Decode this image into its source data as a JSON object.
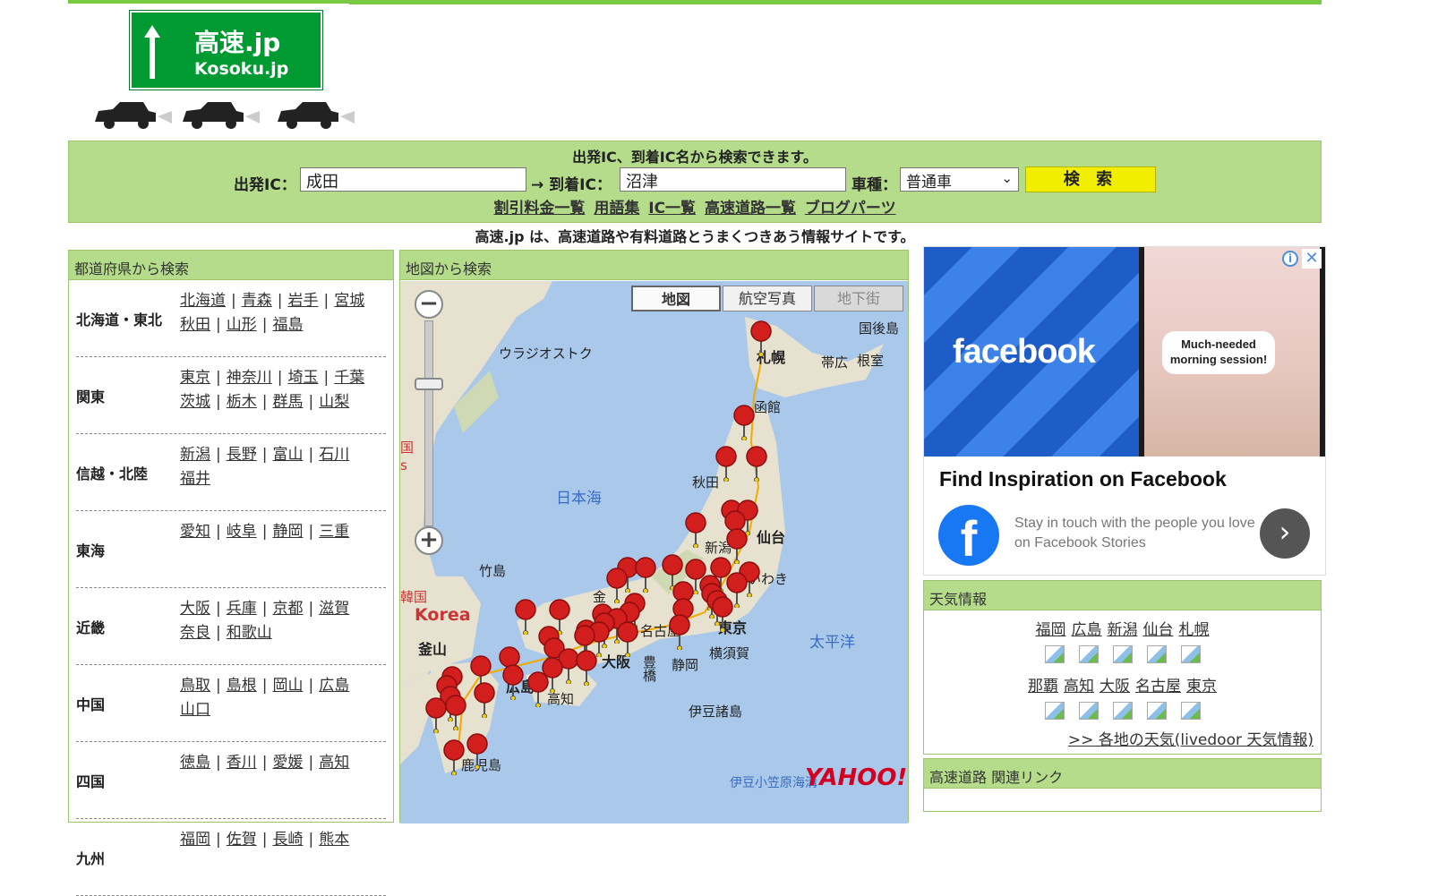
{
  "logo": {
    "line1": "高速.jp",
    "line2": "Kosoku.jp"
  },
  "search": {
    "title": "出発IC、到着IC名から検索できます。",
    "from_label": "出発IC：",
    "from_value": "成田",
    "to_label": "→ 到着IC：",
    "to_value": "沼津",
    "vehicle_label": "車種：",
    "vehicle_value": "普通車",
    "submit_label": "検 索",
    "links": [
      "割引料金一覧",
      "用語集",
      "IC一覧",
      "高速道路一覧",
      "ブログパーツ"
    ]
  },
  "tagline": "高速.jp は、高速道路や有料道路とうまくつきあう情報サイトです。",
  "prefecture_panel": {
    "title": "都道府県から検索",
    "regions": [
      {
        "name": "北海道・東北",
        "prefs": [
          "北海道",
          "青森",
          "岩手",
          "宮城",
          "秋田",
          "山形",
          "福島"
        ]
      },
      {
        "name": "関東",
        "prefs": [
          "東京",
          "神奈川",
          "埼玉",
          "千葉",
          "茨城",
          "栃木",
          "群馬",
          "山梨"
        ]
      },
      {
        "name": "信越・北陸",
        "prefs": [
          "新潟",
          "長野",
          "富山",
          "石川",
          "福井"
        ]
      },
      {
        "name": "東海",
        "prefs": [
          "愛知",
          "岐阜",
          "静岡",
          "三重"
        ]
      },
      {
        "name": "近畿",
        "prefs": [
          "大阪",
          "兵庫",
          "京都",
          "滋賀",
          "奈良",
          "和歌山"
        ]
      },
      {
        "name": "中国",
        "prefs": [
          "鳥取",
          "島根",
          "岡山",
          "広島",
          "山口"
        ]
      },
      {
        "name": "四国",
        "prefs": [
          "徳島",
          "香川",
          "愛媛",
          "高知"
        ]
      },
      {
        "name": "九州",
        "prefs": [
          "福岡",
          "佐賀",
          "長崎",
          "熊本"
        ]
      }
    ]
  },
  "map_panel": {
    "title": "地図から検索",
    "buttons": [
      "地図",
      "航空写真",
      "地下街"
    ],
    "zoom_in": "+",
    "zoom_out": "−",
    "labels": {
      "sapporo": "札幌",
      "obihiro": "帯広",
      "nemuro": "根室",
      "kunashiri": "国後島",
      "vladivostok": "ウラジオストク",
      "hakodate": "函館",
      "akita": "秋田",
      "sea_of_japan": "日本海",
      "niigata": "新潟",
      "sendai": "仙台",
      "iwaki": "いわき",
      "takeshima": "竹島",
      "korea": "Korea",
      "busan": "釜山",
      "tokyo": "東京",
      "nagoya": "名古屋",
      "osaka": "大阪",
      "yokosuka": "横須賀",
      "shizuoka": "静岡",
      "pacific": "太平洋",
      "kochi": "高知",
      "hiroshima": "広島",
      "kagoshima": "鹿児島",
      "toyohashi": "豊橋",
      "izu_islands": "伊豆諸島",
      "ogasawara": "伊豆小笠原海溝",
      "yahoo": "YAHOO!",
      "kanazawa": "金",
      "korea_hanja": "韓国",
      "china_hanja": "国",
      "china_s": "s"
    }
  },
  "ad": {
    "brand": "facebook",
    "bubble": "Much-needed morning session!",
    "title": "Find Inspiration on Facebook",
    "desc": "Stay in touch with the people you love on Facebook Stories",
    "logo_letter": "f"
  },
  "weather": {
    "title": "天気情報",
    "row1": [
      "福岡",
      "広島",
      "新潟",
      "仙台",
      "札幌"
    ],
    "row2": [
      "那覇",
      "高知",
      "大阪",
      "名古屋",
      "東京"
    ],
    "more": ">> 各地の天気(livedoor 天気情報)"
  },
  "related": {
    "title": "高速道路 関連リンク"
  },
  "colors": {
    "accent_green": "#b5dc8a",
    "button_yellow": "#f1ee00",
    "pin_red": "#d31e1e",
    "sign_green": "#009a32"
  }
}
